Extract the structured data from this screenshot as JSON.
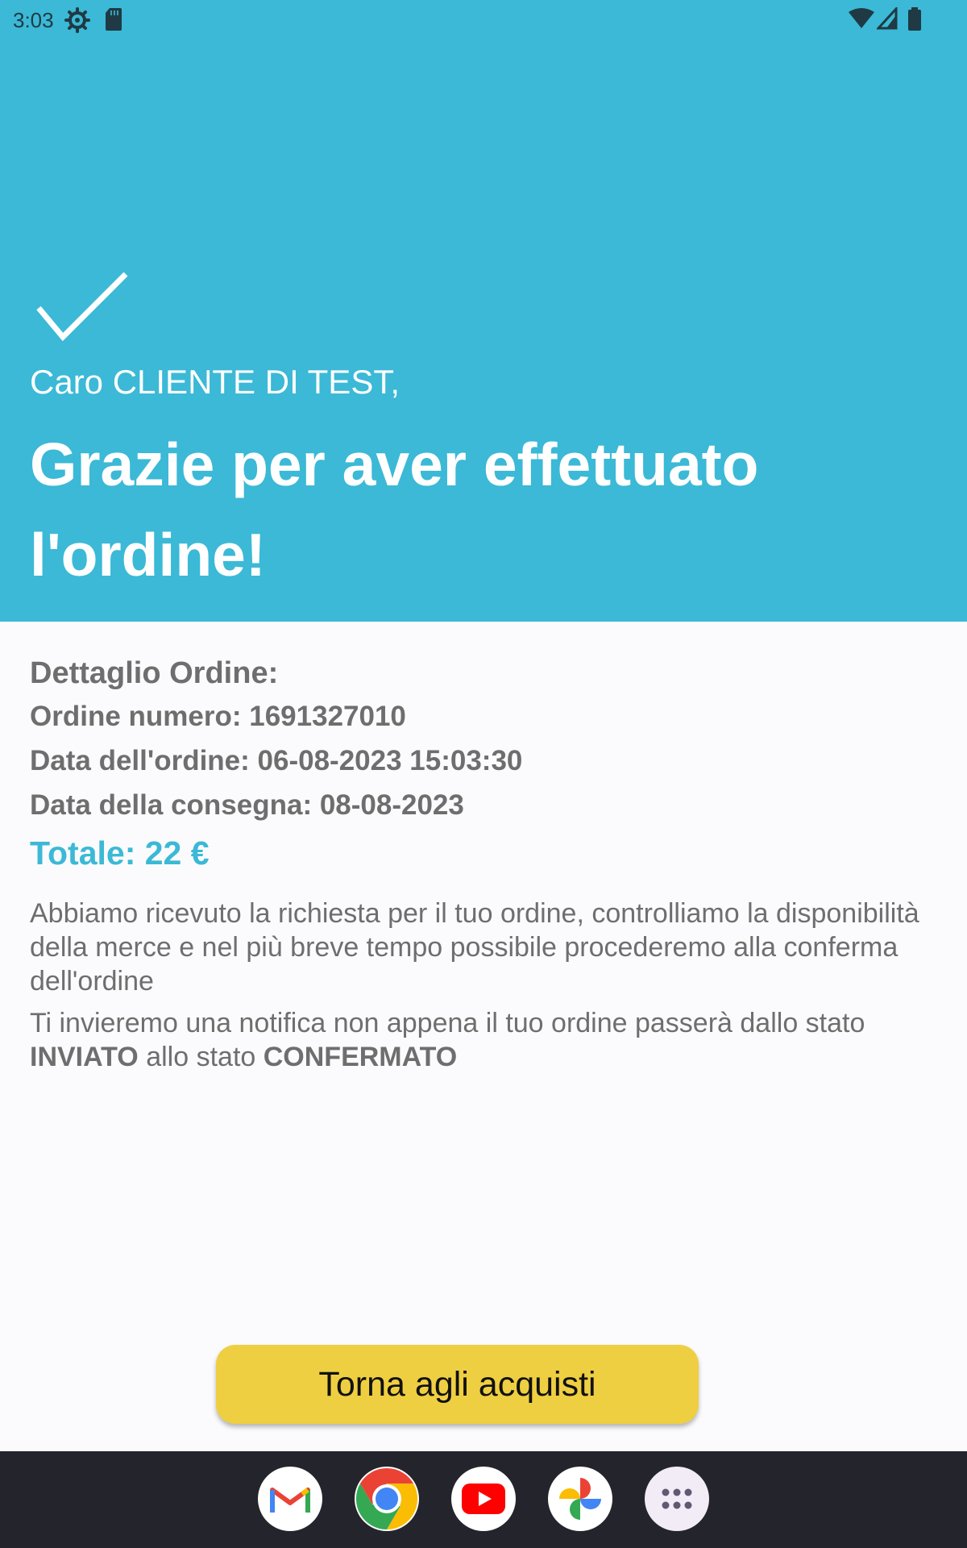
{
  "status_bar": {
    "time": "3:03",
    "icons": [
      "settings-gear-icon",
      "sd-card-icon",
      "wifi-icon",
      "cell-signal-icon",
      "battery-icon"
    ]
  },
  "header": {
    "background_color": "#3bb9d6",
    "icon": "checkmark-icon",
    "greeting": "Caro CLIENTE DI TEST,",
    "headline": "Grazie per aver effettuato l'ordine!"
  },
  "order_details": {
    "title": "Dettaglio Ordine:",
    "order_number": "Ordine numero: 1691327010",
    "order_date": "Data dell'ordine: 06-08-2023 15:03:30",
    "delivery_date": "Data della consegna: 08-08-2023",
    "total": "Totale: 22 €"
  },
  "message": {
    "paragraph1": "Abbiamo ricevuto la richiesta per il tuo ordine, controlliamo la disponibilità della merce e nel più breve tempo possibile procederemo alla conferma dell'ordine",
    "paragraph2_prefix": "Ti invieremo una notifica non appena il tuo ordine passerà dallo stato ",
    "status_from": "INVIATO",
    "paragraph2_middle": " allo stato ",
    "status_to": "CONFERMATO"
  },
  "actions": {
    "back_button_label": "Torna agli acquisti",
    "button_color": "#efcf42"
  },
  "dock": {
    "apps": [
      "gmail-icon",
      "chrome-icon",
      "youtube-icon",
      "photos-icon",
      "app-drawer-icon"
    ]
  }
}
